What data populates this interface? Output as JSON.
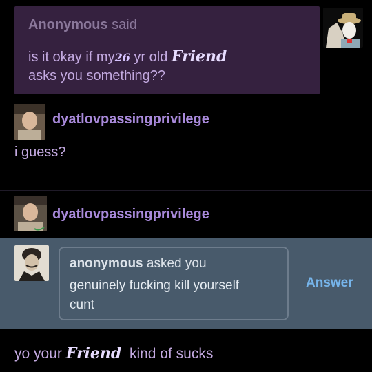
{
  "ask": {
    "asker_name": "Anonymous",
    "asker_suffix": "said",
    "line1_a": "is it okay if my",
    "line1_num": "26",
    "line1_b": "yr old",
    "friend": "Friend",
    "line2": "asks you something??"
  },
  "posts": [
    {
      "username": "dyatlovpassingprivilege",
      "text": "i guess?"
    },
    {
      "username": "dyatlovpassingprivilege"
    }
  ],
  "inbox": {
    "asker": "anonymous",
    "asked_suffix": "asked you",
    "question_line1": "genuinely fucking kill yourself",
    "question_line2": "cunt",
    "answer_label": "Answer"
  },
  "bottom": {
    "part1": "yo your",
    "friend": "Friend",
    "part2": "kind of sucks"
  },
  "colors": {
    "background": "#000000",
    "ask_card": "#35213f",
    "username": "#a889da",
    "inbox_band": "#485a6b",
    "answer": "#76b4ea"
  }
}
